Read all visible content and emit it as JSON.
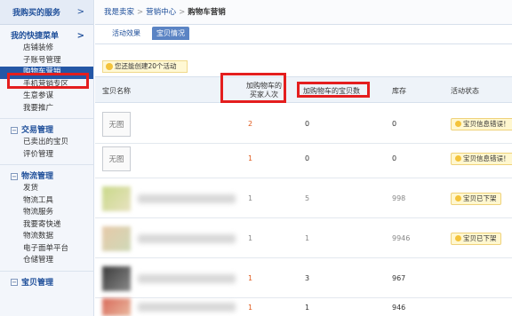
{
  "sidebar": {
    "top_label": "我购买的服务",
    "top_chevron": ">",
    "quick_title": "我的快捷菜单",
    "quick_chevron": ">",
    "quick_items": [
      "店铺装修",
      "子账号管理",
      "购物车营销",
      "手机营销专区",
      "生意参谋",
      "我要推广"
    ],
    "sections": [
      {
        "title": "交易管理",
        "items": [
          "已卖出的宝贝",
          "评价管理"
        ]
      },
      {
        "title": "物流管理",
        "items": [
          "发货",
          "物流工具",
          "物流服务",
          "我要寄快递",
          "物流数据",
          "电子面单平台",
          "仓储管理"
        ]
      },
      {
        "title": "宝贝管理",
        "items": []
      }
    ]
  },
  "breadcrumb": {
    "items": [
      "我是卖家",
      "营销中心",
      "购物车营销"
    ],
    "sep": ">"
  },
  "tabs": [
    "活动效果",
    "宝贝情况"
  ],
  "notice": "您还能创建20个活动",
  "table": {
    "headers": [
      "宝贝名称",
      "加购物车的买家人次",
      "加购物车的宝贝数",
      "库存",
      "活动状态"
    ],
    "rows": [
      {
        "thumb": "无图",
        "buyers": "2",
        "items": "0",
        "stock": "0",
        "status": "宝贝信息错误！"
      },
      {
        "thumb": "无图",
        "buyers": "1",
        "items": "0",
        "stock": "0",
        "status": "宝贝信息错误！"
      },
      {
        "thumb": "",
        "buyers": "1",
        "items": "5",
        "stock": "998",
        "status": "宝贝已下架"
      },
      {
        "thumb": "",
        "buyers": "1",
        "items": "1",
        "stock": "9946",
        "status": "宝贝已下架"
      },
      {
        "thumb": "",
        "buyers": "1",
        "items": "3",
        "stock": "967",
        "status": ""
      },
      {
        "thumb": "",
        "buyers": "1",
        "items": "1",
        "stock": "946",
        "status": ""
      }
    ]
  },
  "colors": {
    "accent": "#1f4f9a",
    "highlight": "#e41e1e",
    "selected": "#2457a6"
  }
}
